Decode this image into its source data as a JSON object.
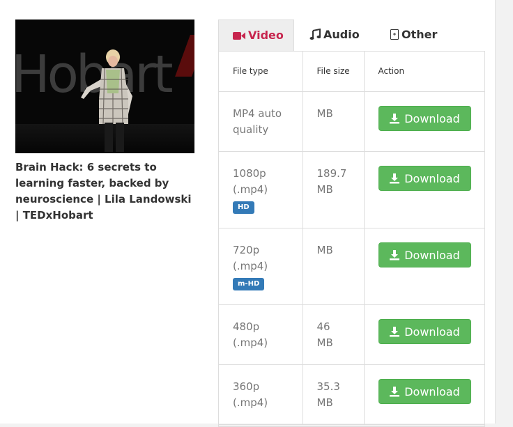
{
  "video": {
    "title": "Brain Hack: 6 secrets to learning faster, backed by neuroscience | Lila Landowski | TEDxHobart",
    "thumbnail_text": "Hobart"
  },
  "tabs": [
    {
      "label": "Video",
      "icon": "video-camera-icon",
      "active": true
    },
    {
      "label": "Audio",
      "icon": "music-note-icon",
      "active": false
    },
    {
      "label": "Other",
      "icon": "file-icon",
      "active": false
    }
  ],
  "table": {
    "headers": [
      "File type",
      "File size",
      "Action"
    ],
    "rows": [
      {
        "file_type": "MP4 auto quality",
        "badge": "",
        "file_size": "MB",
        "action": "Download"
      },
      {
        "file_type": "1080p (.mp4)",
        "badge": "HD",
        "file_size": "189.7 MB",
        "action": "Download"
      },
      {
        "file_type": "720p (.mp4)",
        "badge": "m-HD",
        "file_size": "MB",
        "action": "Download"
      },
      {
        "file_type": "480p (.mp4)",
        "badge": "",
        "file_size": "46 MB",
        "action": "Download"
      },
      {
        "file_type": "360p (.mp4)",
        "badge": "",
        "file_size": "35.3 MB",
        "action": "Download"
      }
    ]
  },
  "colors": {
    "active_tab_text": "#c7254e",
    "download_button": "#5cb85c",
    "badge": "#337ab7"
  }
}
